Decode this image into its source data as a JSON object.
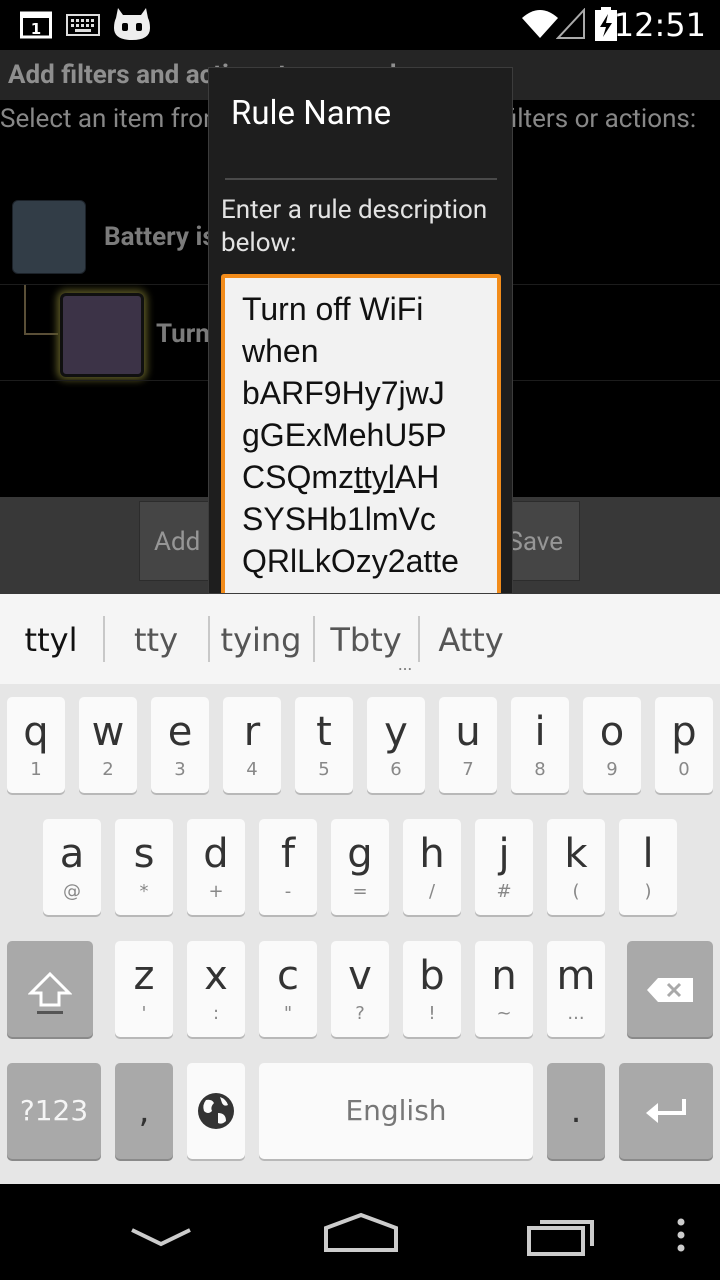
{
  "status_bar": {
    "notifications": [
      "screenshot-notification-icon",
      "keyboard-icon",
      "cyanogenmod-icon"
    ],
    "system_icons": [
      "wifi-icon",
      "cell-signal-icon",
      "battery-charging-icon"
    ],
    "time": "12:51"
  },
  "screen": {
    "title": "Add filters and actions to your rule",
    "instructions": "Select an item from the list below, then add filters or actions:",
    "items": [
      {
        "label": "Battery is low",
        "tile_color": "#4d5e6e"
      },
      {
        "label": "Turn off WiFi",
        "tile_color": "#5c4f6e"
      }
    ],
    "buttons": {
      "add": "Add",
      "save": "Save"
    }
  },
  "dialog": {
    "title": "Rule Name",
    "prompt": "Enter a rule description below:",
    "input_value": "Turn off WiFi when bARF9Hy7jwJgGExMehU5PCSQmzttyIAHSYSHb1lmVcQRlLkOzy2atte",
    "input_lines": [
      "Turn off WiFi",
      "when",
      "bARF9Hy7jwJ",
      "gGExMehU5P",
      "CSQmz",
      "ttyl",
      "AH",
      "SYSHb1lmVc",
      "QRlLkOzy2atte"
    ],
    "accent_color": "#f28c1b"
  },
  "suggestions": {
    "items": [
      "ttyl",
      "tty",
      "tying",
      "Tbty",
      "Atty"
    ],
    "more_indicator": "..."
  },
  "keyboard": {
    "row1": [
      {
        "key": "q",
        "alt": "1"
      },
      {
        "key": "w",
        "alt": "2"
      },
      {
        "key": "e",
        "alt": "3"
      },
      {
        "key": "r",
        "alt": "4"
      },
      {
        "key": "t",
        "alt": "5"
      },
      {
        "key": "y",
        "alt": "6"
      },
      {
        "key": "u",
        "alt": "7"
      },
      {
        "key": "i",
        "alt": "8"
      },
      {
        "key": "o",
        "alt": "9"
      },
      {
        "key": "p",
        "alt": "0"
      }
    ],
    "row2": [
      {
        "key": "a",
        "alt": "@"
      },
      {
        "key": "s",
        "alt": "*"
      },
      {
        "key": "d",
        "alt": "+"
      },
      {
        "key": "f",
        "alt": "-"
      },
      {
        "key": "g",
        "alt": "="
      },
      {
        "key": "h",
        "alt": "/"
      },
      {
        "key": "j",
        "alt": "#"
      },
      {
        "key": "k",
        "alt": "("
      },
      {
        "key": "l",
        "alt": ")"
      }
    ],
    "row3": [
      {
        "key": "z",
        "alt": "'"
      },
      {
        "key": "x",
        "alt": ":"
      },
      {
        "key": "c",
        "alt": "\""
      },
      {
        "key": "v",
        "alt": "?"
      },
      {
        "key": "b",
        "alt": "!"
      },
      {
        "key": "n",
        "alt": "~"
      },
      {
        "key": "m",
        "alt": "..."
      }
    ],
    "symbols_key": "?123",
    "comma_key": ",",
    "space_label": "English",
    "period_key": ".",
    "shift_icon": "shift-icon",
    "delete_icon": "backspace-icon",
    "globe_icon": "globe-icon",
    "enter_icon": "enter-icon"
  },
  "nav_bar": {
    "buttons": [
      "back-icon",
      "home-icon",
      "recents-icon",
      "menu-icon"
    ]
  }
}
